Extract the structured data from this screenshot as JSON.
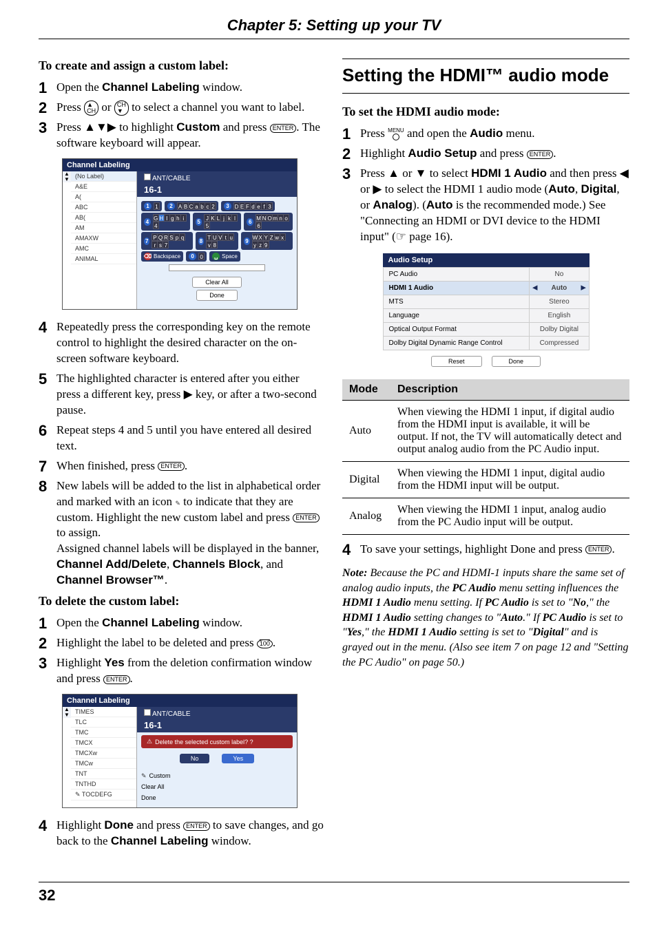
{
  "chapter_title": "Chapter 5: Setting up your TV",
  "page_number": "32",
  "left": {
    "heading_create": "To create and assign a custom label:",
    "steps_create": [
      {
        "n": "1",
        "pre": "Open the ",
        "bold": "Channel Labeling",
        "post": " window."
      },
      {
        "n": "2",
        "text_a": "Press ",
        "icon1": "CH▲",
        "text_b": " or ",
        "icon2": "CH▼",
        "text_c": " to select a channel you want to label."
      },
      {
        "n": "3",
        "text_a": "Press ▲▼▶ to highlight ",
        "bold": "Custom",
        "text_b": " and press ",
        "icon": "ENTER",
        "text_c": ". The software keyboard will appear."
      },
      {
        "n": "4",
        "plain": "Repeatedly press the corresponding key on the remote control to highlight the desired character on the on-screen software keyboard."
      },
      {
        "n": "5",
        "plain": "The highlighted character is entered after you either press a different key, press ▶ key, or after a two-second pause."
      },
      {
        "n": "6",
        "plain": "Repeat steps 4 and 5 until you have entered all desired text."
      },
      {
        "n": "7",
        "text_a": "When finished, press ",
        "icon": "ENTER",
        "text_b": "."
      },
      {
        "n": "8",
        "text_a": "New labels will be added to the list in alphabetical order and marked with an icon ",
        "pencil": "✎",
        "text_b": " to indicate that they are custom. Highlight the new custom label and press ",
        "icon": "ENTER",
        "text_c": " to assign.",
        "extra_a": "Assigned channel labels will be displayed in the banner, ",
        "bold1": "Channel Add/Delete",
        "extra_b": ", ",
        "bold2": "Channels Block",
        "extra_c": ", and ",
        "bold3": "Channel Browser™",
        "extra_d": "."
      }
    ],
    "heading_delete": "To delete the custom label:",
    "steps_delete": [
      {
        "n": "1",
        "pre": "Open the ",
        "bold": "Channel Labeling",
        "post": " window."
      },
      {
        "n": "2",
        "text_a": "Highlight the label to be deleted and press ",
        "icon": "100",
        "text_b": "."
      },
      {
        "n": "3",
        "text_a": "Highlight ",
        "bold": "Yes",
        "text_b": " from the deletion confirmation window and press ",
        "icon": "ENTER",
        "text_c": "."
      },
      {
        "n": "4",
        "text_a": "Highlight ",
        "bold": "Done",
        "text_b": " and press ",
        "icon": "ENTER",
        "text_c": " to save changes, and go back to the ",
        "bold2": "Channel Labeling",
        "text_d": " window."
      }
    ],
    "screenshot1": {
      "title": "Channel Labeling",
      "ant_label": "ANT/CABLE",
      "channel": "16-1",
      "channels": [
        "(No Label)",
        "A&E",
        "A(",
        "ABC",
        "AB(",
        "AM",
        "AMAXW",
        "AMC",
        "ANIMAL"
      ],
      "kb_rows": [
        {
          "n": "1",
          "chars": "1"
        },
        {
          "n": "2",
          "chars": "ABCabc2"
        },
        {
          "n": "3",
          "chars": "DEFdef3"
        },
        {
          "n": "4",
          "chars": "GHIghi4",
          "sel": 1
        },
        {
          "n": "5",
          "chars": "JKLjkl5"
        },
        {
          "n": "6",
          "chars": "MNOmno6"
        },
        {
          "n": "7",
          "chars": "PQRSpqrs7"
        },
        {
          "n": "8",
          "chars": "TUVtuv8"
        },
        {
          "n": "9",
          "chars": "WXYZwxyz9"
        },
        {
          "n": "BK",
          "chars": "Backspace"
        },
        {
          "n": "0",
          "chars": "0"
        },
        {
          "n": "SP",
          "chars": "Space"
        }
      ],
      "buttons": [
        "Clear All",
        "Done"
      ]
    },
    "screenshot2": {
      "title": "Channel Labeling",
      "ant_label": "ANT/CABLE",
      "channel": "16-1",
      "delete_msg": "Delete the selected custom label? ?",
      "no": "No",
      "yes": "Yes",
      "custom": "Custom",
      "clear_all": "Clear All",
      "done": "Done",
      "channels": [
        "TIMES",
        "TLC",
        "TMC",
        "TMCX",
        "TMCXw",
        "TMCw",
        "TNT",
        "TNTHD",
        "TOCDEFG"
      ]
    }
  },
  "right": {
    "section_title": "Setting the HDMI™ audio mode",
    "heading_set": "To set the HDMI audio mode:",
    "steps": [
      {
        "n": "1",
        "text_a": "Press ",
        "menu": "MENU",
        "text_b": " and open the ",
        "bold": "Audio",
        "text_c": " menu."
      },
      {
        "n": "2",
        "text_a": "Highlight ",
        "bold": "Audio Setup",
        "text_b": " and press ",
        "icon": "ENTER",
        "text_c": "."
      },
      {
        "n": "3",
        "text_a": "Press ▲ or ▼ to select ",
        "bold": "HDMI 1 Audio",
        "text_b": " and then press ◀ or ▶ to select the HDMI 1 audio mode (",
        "bold2": "Auto",
        "text_c": ", ",
        "bold3": "Digital",
        "text_d": ", or ",
        "bold4": "Analog",
        "text_e": "). (",
        "bold5": "Auto",
        "text_f": " is the recommended mode.) See \"Connecting an HDMI or DVI device to the HDMI input\" (☞ page 16)."
      },
      {
        "n": "4",
        "text_a": "To save your settings, highlight Done and press ",
        "icon": "ENTER",
        "text_b": "."
      }
    ],
    "audio_setup": {
      "title": "Audio Setup",
      "rows": [
        {
          "label": "PC Audio",
          "value": "No"
        },
        {
          "label": "HDMI 1 Audio",
          "value": "Auto",
          "sel": true
        },
        {
          "label": "MTS",
          "value": "Stereo"
        },
        {
          "label": "Language",
          "value": "English"
        },
        {
          "label": "Optical Output Format",
          "value": "Dolby Digital"
        },
        {
          "label": "Dolby Digital Dynamic Range Control",
          "value": "Compressed"
        }
      ],
      "reset": "Reset",
      "done": "Done"
    },
    "mode_table": {
      "head_mode": "Mode",
      "head_desc": "Description",
      "rows": [
        {
          "mode": "Auto",
          "desc": "When viewing the HDMI 1 input, if digital audio from the HDMI input is available, it will be output. If not, the TV will automatically detect and output analog audio from the PC Audio input."
        },
        {
          "mode": "Digital",
          "desc": "When viewing the HDMI 1 input, digital audio from the HDMI input will be output."
        },
        {
          "mode": "Analog",
          "desc": "When viewing the HDMI 1 input, analog audio from the PC Audio input will be output."
        }
      ]
    },
    "note": {
      "lead": "Note:",
      "body_a": " Because the PC and HDMI-1 inputs share the same set of analog audio inputs, the ",
      "b1": "PC Audio",
      "body_b": " menu setting influences the ",
      "b2": "HDMI 1 Audio",
      "body_c": " menu setting. If ",
      "b3": "PC Audio",
      "body_d": " is set to \"",
      "b4": "No",
      "body_e": ",\" the ",
      "b5": "HDMI 1 Audio",
      "body_f": " setting changes to \"",
      "b6": "Auto",
      "body_g": ".\" If ",
      "b7": "PC Audio",
      "body_h": " is set to \"",
      "b8": "Yes",
      "body_i": ",\" the ",
      "b9": "HDMI 1 Audio",
      "body_j": " setting is set to \"",
      "b10": "Digital",
      "body_k": "\" and is grayed out in the menu. (Also see item 7 on page 12 and \"Setting the PC Audio\" on page 50.)"
    }
  }
}
